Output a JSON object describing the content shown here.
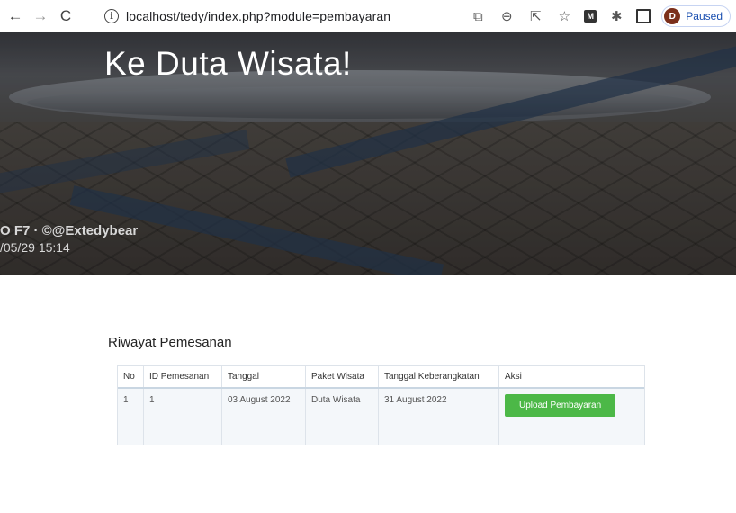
{
  "browser": {
    "url": "localhost/tedy/index.php?module=pembayaran",
    "profile_initial": "D",
    "profile_status": "Paused"
  },
  "hero": {
    "title": "Ke Duta Wisata!",
    "watermark_line1": "O F7 · ©@Extedybear",
    "watermark_line2": "/05/29 15:14"
  },
  "history": {
    "title": "Riwayat Pemesanan",
    "columns": [
      "No",
      "ID Pemesanan",
      "Tanggal",
      "Paket Wisata",
      "Tanggal Keberangkatan",
      "Aksi"
    ],
    "rows": [
      {
        "no": "1",
        "id": "1",
        "tanggal": "03 August 2022",
        "paket": "Duta Wisata",
        "keberangkatan": "31 August 2022",
        "action_label": "Upload Pembayaran"
      }
    ]
  },
  "colors": {
    "action_button": "#4cb847"
  }
}
